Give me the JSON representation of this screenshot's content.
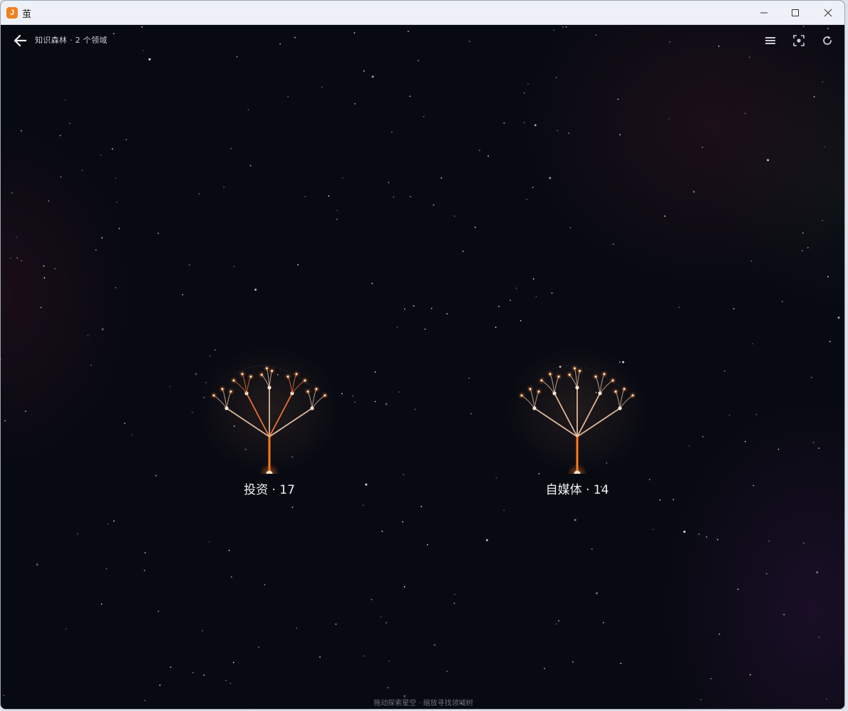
{
  "window": {
    "title": "茧",
    "app_icon_letter": "J"
  },
  "topbar": {
    "breadcrumb": "知识森林 · 2 个领域",
    "tools": [
      "list-icon",
      "focus-icon",
      "refresh-icon"
    ]
  },
  "forest": {
    "domains": [
      {
        "label": "投资 · 17"
      },
      {
        "label": "自媒体 · 14"
      }
    ]
  },
  "footer": {
    "hint": "拖动探索星空 · 缩放寻找领域树"
  },
  "colors": {
    "accent": "#ff7a1a",
    "branch": "#f4c9a8",
    "background": "#080a12"
  }
}
